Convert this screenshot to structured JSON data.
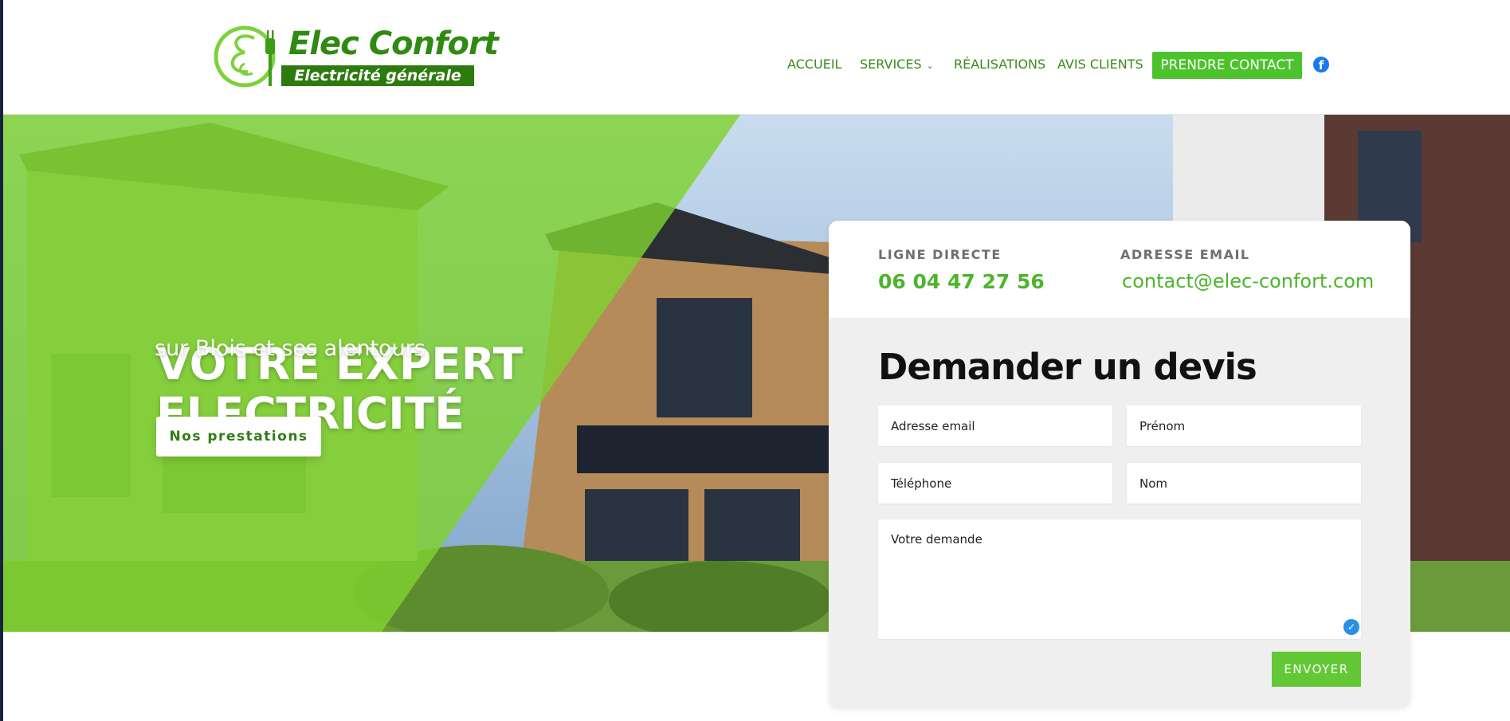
{
  "brand": {
    "name": "Elec Confort",
    "tagline": "Electricité générale"
  },
  "nav": {
    "items": [
      {
        "label": "ACCUEIL"
      },
      {
        "label": "SERVICES"
      },
      {
        "label": "RÉALISATIONS"
      },
      {
        "label": "AVIS CLIENTS"
      }
    ],
    "cta_label": "PRENDRE CONTACT",
    "facebook_icon": "f"
  },
  "hero": {
    "title_line1": "VOTRE EXPERT",
    "title_line2": "ELECTRICITÉ",
    "subtitle": "sur Blois et ses alentours",
    "button_label": "Nos prestations"
  },
  "contact": {
    "phone_label": "LIGNE DIRECTE",
    "phone": "06 04 47 27 56",
    "email_label": "ADRESSE EMAIL",
    "email": "contact@elec-confort.com"
  },
  "form": {
    "title": "Demander un devis",
    "email_placeholder": "Adresse email",
    "firstname_placeholder": "Prénom",
    "phone_placeholder": "Téléphone",
    "lastname_placeholder": "Nom",
    "message_placeholder": "Votre demande",
    "submit_label": "ENVOYER"
  },
  "colors": {
    "brand_green": "#4cc22d",
    "dark_green": "#2d7a0e",
    "text_green": "#3b8a1a"
  }
}
